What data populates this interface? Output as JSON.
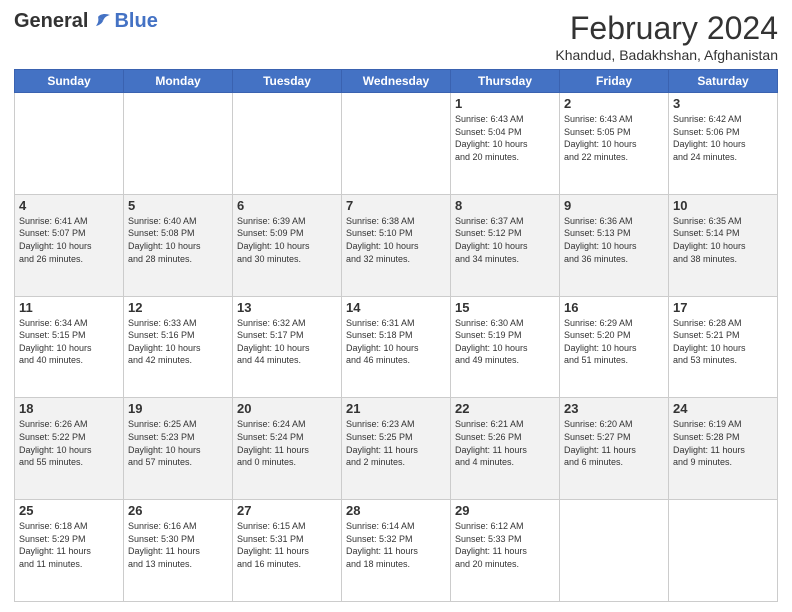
{
  "header": {
    "logo_general": "General",
    "logo_blue": "Blue",
    "title": "February 2024",
    "location": "Khandud, Badakhshan, Afghanistan"
  },
  "days": [
    "Sunday",
    "Monday",
    "Tuesday",
    "Wednesday",
    "Thursday",
    "Friday",
    "Saturday"
  ],
  "weeks": [
    [
      {
        "date": "",
        "info": ""
      },
      {
        "date": "",
        "info": ""
      },
      {
        "date": "",
        "info": ""
      },
      {
        "date": "",
        "info": ""
      },
      {
        "date": "1",
        "info": "Sunrise: 6:43 AM\nSunset: 5:04 PM\nDaylight: 10 hours\nand 20 minutes."
      },
      {
        "date": "2",
        "info": "Sunrise: 6:43 AM\nSunset: 5:05 PM\nDaylight: 10 hours\nand 22 minutes."
      },
      {
        "date": "3",
        "info": "Sunrise: 6:42 AM\nSunset: 5:06 PM\nDaylight: 10 hours\nand 24 minutes."
      }
    ],
    [
      {
        "date": "4",
        "info": "Sunrise: 6:41 AM\nSunset: 5:07 PM\nDaylight: 10 hours\nand 26 minutes."
      },
      {
        "date": "5",
        "info": "Sunrise: 6:40 AM\nSunset: 5:08 PM\nDaylight: 10 hours\nand 28 minutes."
      },
      {
        "date": "6",
        "info": "Sunrise: 6:39 AM\nSunset: 5:09 PM\nDaylight: 10 hours\nand 30 minutes."
      },
      {
        "date": "7",
        "info": "Sunrise: 6:38 AM\nSunset: 5:10 PM\nDaylight: 10 hours\nand 32 minutes."
      },
      {
        "date": "8",
        "info": "Sunrise: 6:37 AM\nSunset: 5:12 PM\nDaylight: 10 hours\nand 34 minutes."
      },
      {
        "date": "9",
        "info": "Sunrise: 6:36 AM\nSunset: 5:13 PM\nDaylight: 10 hours\nand 36 minutes."
      },
      {
        "date": "10",
        "info": "Sunrise: 6:35 AM\nSunset: 5:14 PM\nDaylight: 10 hours\nand 38 minutes."
      }
    ],
    [
      {
        "date": "11",
        "info": "Sunrise: 6:34 AM\nSunset: 5:15 PM\nDaylight: 10 hours\nand 40 minutes."
      },
      {
        "date": "12",
        "info": "Sunrise: 6:33 AM\nSunset: 5:16 PM\nDaylight: 10 hours\nand 42 minutes."
      },
      {
        "date": "13",
        "info": "Sunrise: 6:32 AM\nSunset: 5:17 PM\nDaylight: 10 hours\nand 44 minutes."
      },
      {
        "date": "14",
        "info": "Sunrise: 6:31 AM\nSunset: 5:18 PM\nDaylight: 10 hours\nand 46 minutes."
      },
      {
        "date": "15",
        "info": "Sunrise: 6:30 AM\nSunset: 5:19 PM\nDaylight: 10 hours\nand 49 minutes."
      },
      {
        "date": "16",
        "info": "Sunrise: 6:29 AM\nSunset: 5:20 PM\nDaylight: 10 hours\nand 51 minutes."
      },
      {
        "date": "17",
        "info": "Sunrise: 6:28 AM\nSunset: 5:21 PM\nDaylight: 10 hours\nand 53 minutes."
      }
    ],
    [
      {
        "date": "18",
        "info": "Sunrise: 6:26 AM\nSunset: 5:22 PM\nDaylight: 10 hours\nand 55 minutes."
      },
      {
        "date": "19",
        "info": "Sunrise: 6:25 AM\nSunset: 5:23 PM\nDaylight: 10 hours\nand 57 minutes."
      },
      {
        "date": "20",
        "info": "Sunrise: 6:24 AM\nSunset: 5:24 PM\nDaylight: 11 hours\nand 0 minutes."
      },
      {
        "date": "21",
        "info": "Sunrise: 6:23 AM\nSunset: 5:25 PM\nDaylight: 11 hours\nand 2 minutes."
      },
      {
        "date": "22",
        "info": "Sunrise: 6:21 AM\nSunset: 5:26 PM\nDaylight: 11 hours\nand 4 minutes."
      },
      {
        "date": "23",
        "info": "Sunrise: 6:20 AM\nSunset: 5:27 PM\nDaylight: 11 hours\nand 6 minutes."
      },
      {
        "date": "24",
        "info": "Sunrise: 6:19 AM\nSunset: 5:28 PM\nDaylight: 11 hours\nand 9 minutes."
      }
    ],
    [
      {
        "date": "25",
        "info": "Sunrise: 6:18 AM\nSunset: 5:29 PM\nDaylight: 11 hours\nand 11 minutes."
      },
      {
        "date": "26",
        "info": "Sunrise: 6:16 AM\nSunset: 5:30 PM\nDaylight: 11 hours\nand 13 minutes."
      },
      {
        "date": "27",
        "info": "Sunrise: 6:15 AM\nSunset: 5:31 PM\nDaylight: 11 hours\nand 16 minutes."
      },
      {
        "date": "28",
        "info": "Sunrise: 6:14 AM\nSunset: 5:32 PM\nDaylight: 11 hours\nand 18 minutes."
      },
      {
        "date": "29",
        "info": "Sunrise: 6:12 AM\nSunset: 5:33 PM\nDaylight: 11 hours\nand 20 minutes."
      },
      {
        "date": "",
        "info": ""
      },
      {
        "date": "",
        "info": ""
      }
    ]
  ]
}
